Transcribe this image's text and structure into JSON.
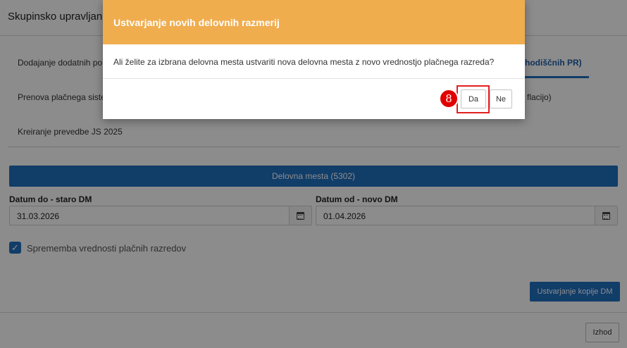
{
  "page": {
    "title": "Skupinsko upravljan",
    "menu": [
      {
        "label": "Dodajanje dodatnih po"
      },
      {
        "label": "hodiščnih PR)"
      },
      {
        "label": "Prenova plačnega siste"
      },
      {
        "label": "flacijo)"
      },
      {
        "label": "Kreiranje prevedbe JS 2025"
      }
    ],
    "count_bar": "Delovna mesta (5302)",
    "date_to_label": "Datum do - staro DM",
    "date_to_value": "31.03.2026",
    "date_from_label": "Datum od - novo DM",
    "date_from_value": "01.04.2026",
    "checkbox_label": "Sprememba vrednosti plačnih razredov",
    "checkbox_checked": true,
    "create_copy_button": "Ustvarjanje kopije DM",
    "exit_button": "Izhod"
  },
  "modal": {
    "title": "Ustvarjanje novih delovnih razmerij",
    "question": "Ali želite za izbrana delovna mesta ustvariti nova delovna mesta z novo vrednostjo plačnega razreda?",
    "yes_button": "Da",
    "no_button": "Ne"
  },
  "annotation": {
    "step_number": "8"
  },
  "colors": {
    "primary": "#1f6fc0",
    "modal_header": "#f0ad4e",
    "highlight": "#e02020"
  }
}
